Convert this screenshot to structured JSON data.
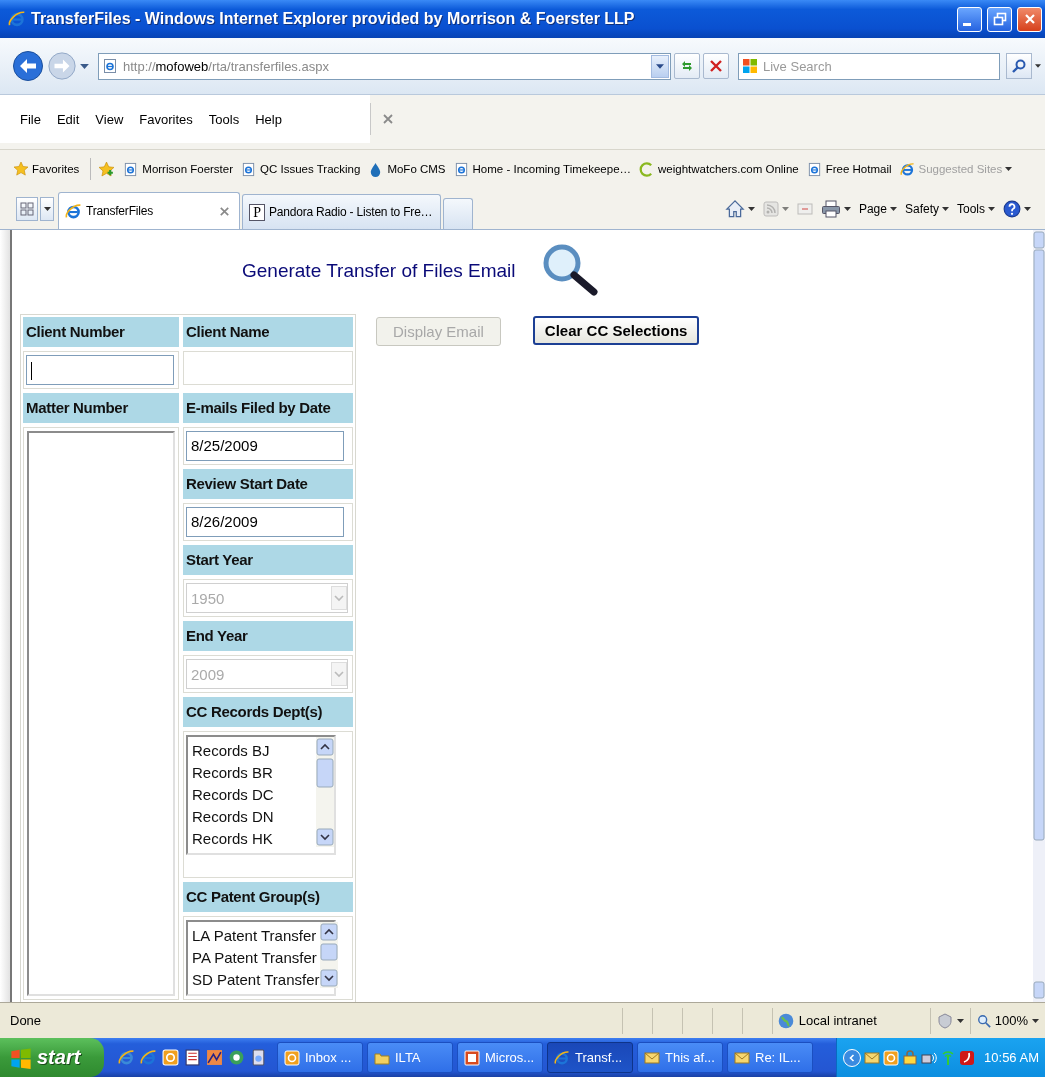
{
  "window": {
    "title": "TransferFiles - Windows Internet Explorer provided by Morrison & Foerster LLP"
  },
  "address_bar": {
    "url": "http://**mofoweb**/rta/transferfiles.aspx"
  },
  "search": {
    "placeholder": "Live Search"
  },
  "menu": [
    "File",
    "Edit",
    "View",
    "Favorites",
    "Tools",
    "Help"
  ],
  "favorites_bar": {
    "label": "Favorites",
    "items": [
      {
        "label": "Morrison  Foerster",
        "kind": "page",
        "disabled": false
      },
      {
        "label": "QC Issues Tracking",
        "kind": "page",
        "disabled": false
      },
      {
        "label": "MoFo CMS",
        "kind": "drop",
        "disabled": false
      },
      {
        "label": "Home - Incoming Timekeepe…",
        "kind": "page",
        "disabled": false
      },
      {
        "label": "weightwatchers.com Online",
        "kind": "ring",
        "disabled": false
      },
      {
        "label": "Free Hotmail",
        "kind": "page",
        "disabled": false
      },
      {
        "label": "Suggested Sites",
        "kind": "menu",
        "disabled": true
      }
    ]
  },
  "tabs": [
    {
      "label": "TransferFiles",
      "kind": "browser",
      "selected": true
    },
    {
      "label": "Pandora Radio - Listen to Fre…",
      "kind": "site",
      "favicon": "P",
      "selected": false
    }
  ],
  "command_bar": [
    "Page",
    "Safety",
    "Tools"
  ],
  "page": {
    "heading": "Generate Transfer of Files Email",
    "left_column": [
      {
        "kind": "header",
        "text": "Client Number"
      },
      {
        "kind": "input",
        "focused": true
      },
      {
        "kind": "header",
        "text": "Matter Number"
      },
      {
        "kind": "listbox"
      }
    ],
    "right_column": [
      {
        "kind": "header",
        "text": "Client Name"
      },
      {
        "kind": "blank"
      },
      {
        "kind": "header",
        "text": "E-mails Filed by Date"
      },
      {
        "kind": "input",
        "value": "8/25/2009",
        "focused": false
      },
      {
        "kind": "header",
        "text": "Review Start Date"
      },
      {
        "kind": "input",
        "value": "8/26/2009",
        "focused": false
      },
      {
        "kind": "header",
        "text": "Start Year"
      },
      {
        "kind": "select",
        "value": "1950",
        "disabled": true
      },
      {
        "kind": "header",
        "text": "End Year"
      },
      {
        "kind": "select",
        "value": "2009",
        "disabled": true
      },
      {
        "kind": "header",
        "text": "CC Records Dept(s)"
      },
      {
        "kind": "listbox",
        "items": [
          {
            "label": "Records BJ",
            "selected": false
          },
          {
            "label": "Records BR",
            "selected": false
          },
          {
            "label": "Records DC",
            "selected": false
          },
          {
            "label": "Records DN",
            "selected": false
          },
          {
            "label": "Records HK",
            "selected": false
          }
        ]
      },
      {
        "kind": "header",
        "text": "CC Patent Group(s)"
      },
      {
        "kind": "listbox",
        "items": [
          {
            "label": "LA Patent Transfer",
            "selected": false
          },
          {
            "label": "PA Patent Transfer",
            "selected": false
          },
          {
            "label": "SD Patent Transfer",
            "selected": false
          }
        ]
      }
    ],
    "buttons": [
      {
        "label": "Display Email",
        "disabled": true
      },
      {
        "label": "Clear CC Selections",
        "disabled": false
      }
    ]
  },
  "status_bar": {
    "text": "Done",
    "zone": "Local intranet",
    "zoom": "100%"
  },
  "taskbar": {
    "start": "start",
    "tasks": [
      {
        "label": "Inbox ...",
        "kind": "outlook",
        "selected": false
      },
      {
        "label": "ILTA",
        "kind": "folder",
        "selected": false
      },
      {
        "label": "Micros...",
        "kind": "office",
        "selected": false
      },
      {
        "label": "Transf...",
        "kind": "browser",
        "selected": true
      },
      {
        "label": "This af...",
        "kind": "mail",
        "selected": false
      },
      {
        "label": "Re: IL...",
        "kind": "mail",
        "selected": false
      }
    ],
    "clock": "10:56 AM"
  }
}
